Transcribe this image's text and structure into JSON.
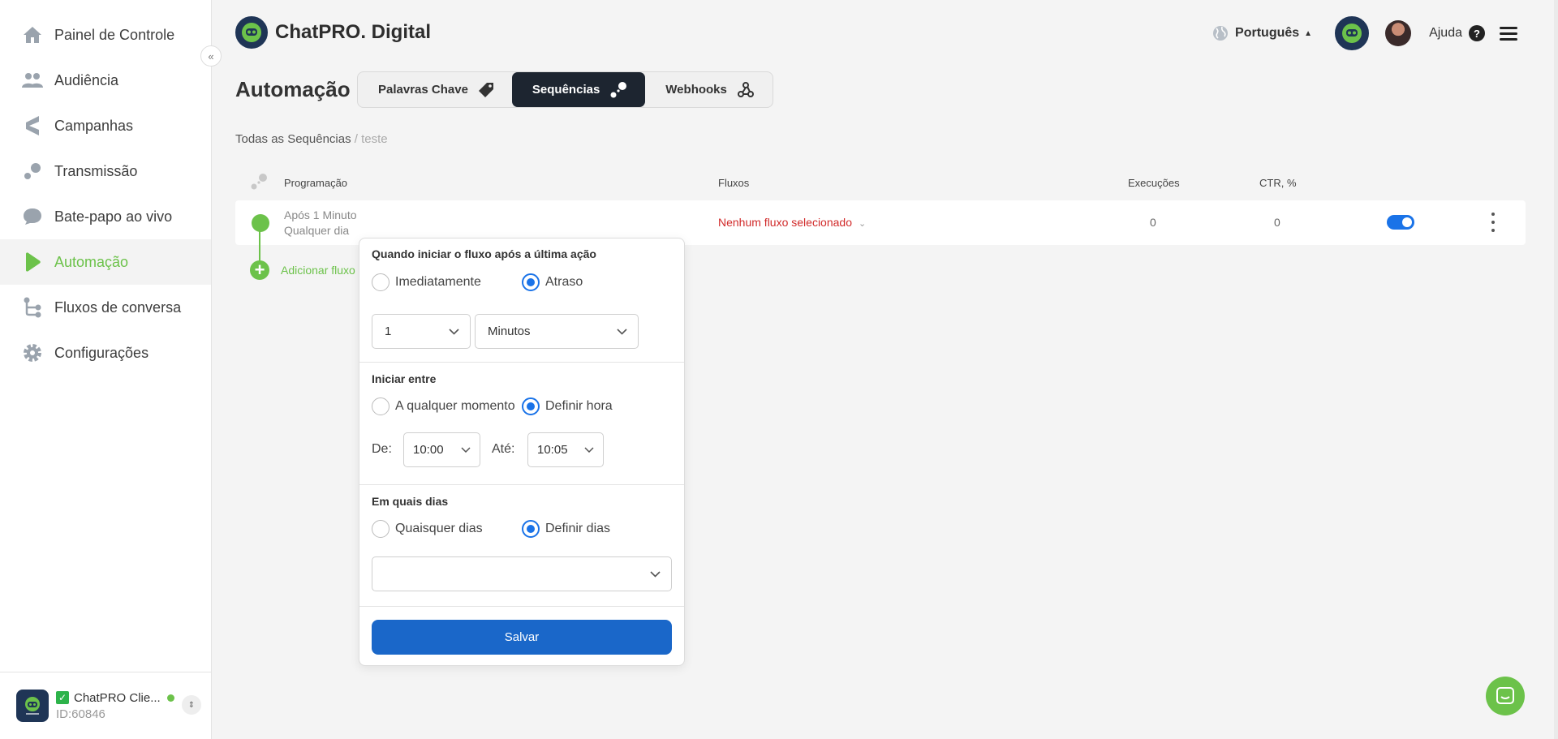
{
  "sidebar": {
    "items": [
      {
        "label": "Painel de Controle",
        "icon": "home-icon"
      },
      {
        "label": "Audiência",
        "icon": "people-icon"
      },
      {
        "label": "Campanhas",
        "icon": "campaign-icon"
      },
      {
        "label": "Transmissão",
        "icon": "broadcast-icon"
      },
      {
        "label": "Bate-papo ao vivo",
        "icon": "chat-bubble-icon"
      },
      {
        "label": "Automação",
        "icon": "play-icon",
        "active": true
      },
      {
        "label": "Fluxos de conversa",
        "icon": "flow-icon"
      },
      {
        "label": "Configurações",
        "icon": "gear-icon"
      }
    ],
    "account": {
      "name": "ChatPRO Clie...",
      "id": "ID:60846",
      "logo_text": "ChatPRO"
    }
  },
  "header": {
    "brand": "ChatPRO. Digital",
    "language": "Português",
    "help": "Ajuda"
  },
  "page": {
    "title": "Automação",
    "tabs": [
      {
        "label": "Palavras Chave",
        "icon": "tag-icon"
      },
      {
        "label": "Sequências",
        "icon": "sequence-icon",
        "active": true
      },
      {
        "label": "Webhooks",
        "icon": "webhook-icon"
      }
    ],
    "breadcrumb": {
      "root": "Todas as Sequências",
      "separator": " / ",
      "current": "teste"
    }
  },
  "table": {
    "headers": {
      "schedule": "Programação",
      "flows": "Fluxos",
      "executions": "Execuções",
      "ctr": "CTR, %"
    },
    "rows": [
      {
        "schedule_line1": "Após 1 Minuto",
        "schedule_line2": "Qualquer dia",
        "flow": "Nenhum fluxo selecionado",
        "executions": "0",
        "ctr": "0",
        "enabled": true
      }
    ],
    "add_flow": "Adicionar fluxo"
  },
  "popover": {
    "start": {
      "title": "Quando iniciar o fluxo após a última ação",
      "opt_immediate": "Imediatamente",
      "opt_delay": "Atraso",
      "selected": "delay",
      "amount": "1",
      "unit": "Minutos"
    },
    "window": {
      "title": "Iniciar entre",
      "opt_any": "A qualquer momento",
      "opt_set": "Definir hora",
      "selected": "set",
      "from_label": "De:",
      "from": "10:00",
      "to_label": "Até:",
      "to": "10:05"
    },
    "days": {
      "title": "Em quais dias",
      "opt_any": "Quaisquer dias",
      "opt_set": "Definir dias",
      "selected": "set",
      "value": ""
    },
    "save": "Salvar"
  },
  "colors": {
    "accent": "#6cc24a",
    "primary": "#1a67c9",
    "dark_tab": "#1d2530",
    "error": "#d12a2a"
  }
}
